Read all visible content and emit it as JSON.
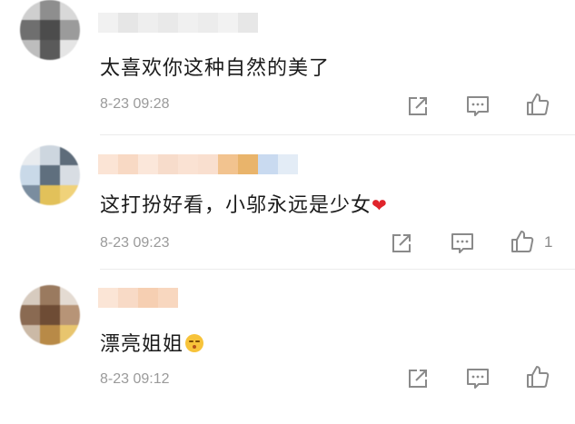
{
  "comments": [
    {
      "text": "太喜欢你这种自然的美了",
      "time": "8-23 09:28",
      "likes": ""
    },
    {
      "text": "这打扮好看，小邬永远是少女",
      "heart": "❤",
      "time": "8-23 09:23",
      "likes": "1"
    },
    {
      "text": "漂亮姐姐",
      "time": "8-23 09:12",
      "likes": ""
    }
  ],
  "icons": [
    "share-icon",
    "comment-icon",
    "like-icon"
  ],
  "colors": {
    "timestamp": "#9a9a9a",
    "heart": "#e0242b",
    "icon": "#8a8a8a"
  }
}
